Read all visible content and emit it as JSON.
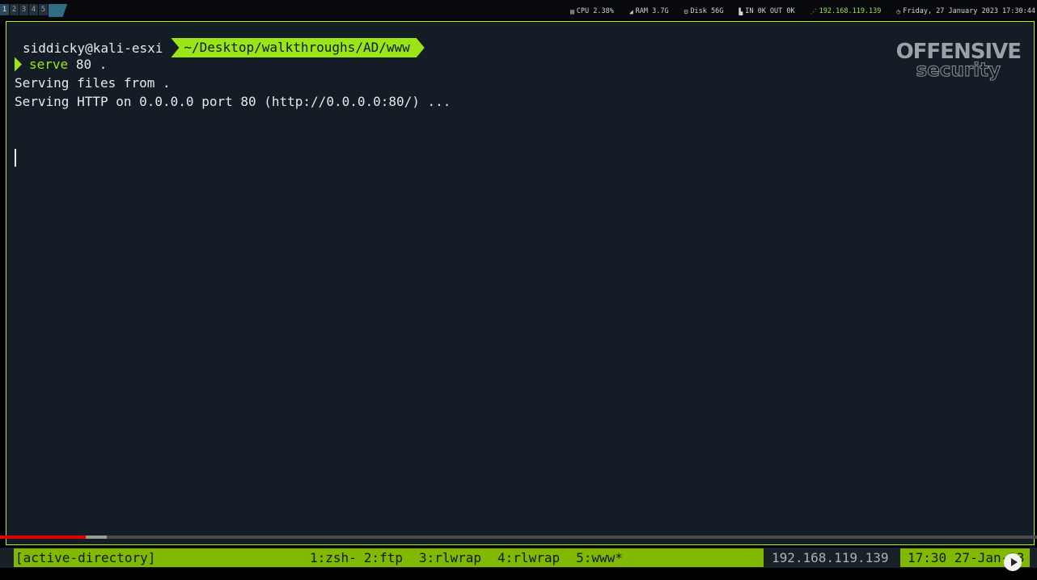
{
  "topbar": {
    "workspaces": [
      "1",
      "2",
      "3",
      "4",
      "5"
    ],
    "active_workspace": "1",
    "stats": {
      "cpu": "CPU 2.38%",
      "ram": "RAM 3.7G",
      "disk": "Disk 56G",
      "net": "IN 0K OUT 0K",
      "ip": "192.168.119.139",
      "datetime": "Friday, 27 January 2023 17:30:44"
    }
  },
  "terminal": {
    "prompt_user_host": "siddicky@kali-esxi",
    "prompt_cwd": "~/Desktop/walkthroughs/AD/www",
    "command_name": "serve",
    "command_args": "80 .",
    "output": [
      "Serving files from .",
      "Serving HTTP on 0.0.0.0 port 80 (http://0.0.0.0:80/) ..."
    ]
  },
  "logo": {
    "line1": "OFFENSIVE",
    "line2": "security"
  },
  "video": {
    "played_fraction": 0.083,
    "buffered_fraction": 0.103
  },
  "tmux": {
    "session": "[active-directory]",
    "windows": [
      "1:zsh-",
      "2:ftp",
      "3:rlwrap",
      "4:rlwrap",
      "5:www*"
    ],
    "ip": "192.168.119.139",
    "clock": "17:30 27-Jan-23"
  },
  "colors": {
    "accent": "#9be516",
    "status_green": "#81b900",
    "terminal_bg": "#141d26",
    "border": "#b6f016"
  }
}
